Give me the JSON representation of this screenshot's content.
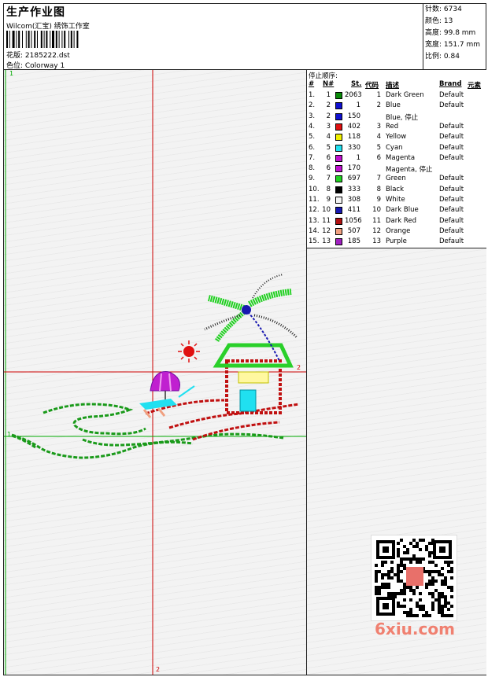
{
  "header": {
    "title": "生产作业图",
    "subtitle": "Wilcom(汇宝) 绣饰工作室",
    "design_file": "花版: 2185222.dst",
    "colorway": "色位: Colorway 1"
  },
  "stats": {
    "stitches": "针数: 6734",
    "colors": "颜色: 13",
    "height": "高度: 99.8 mm",
    "width": "宽度: 151.7 mm",
    "scale": "比例: 0.84"
  },
  "canvas": {
    "marker_top_left": "1",
    "marker_right": "2",
    "marker_bottom": "2",
    "marker_left": "1"
  },
  "stop_table": {
    "heading": "停止顺序:",
    "columns": [
      "#",
      "N#",
      "St.",
      "代码",
      "描述",
      "Brand",
      "元素"
    ],
    "rows": [
      {
        "idx": "1.",
        "n": "1",
        "color": "#0a8a0a",
        "st": "2063",
        "code": "1",
        "desc": "Dark Green",
        "brand": "Default"
      },
      {
        "idx": "2.",
        "n": "2",
        "color": "#1010d0",
        "st": "1",
        "code": "2",
        "desc": "Blue",
        "brand": "Default"
      },
      {
        "idx": "3.",
        "n": "2",
        "color": "#1010d0",
        "st": "150",
        "code": "",
        "desc": "Blue, 停止",
        "brand": ""
      },
      {
        "idx": "4.",
        "n": "3",
        "color": "#e01010",
        "st": "402",
        "code": "3",
        "desc": "Red",
        "brand": "Default"
      },
      {
        "idx": "5.",
        "n": "4",
        "color": "#f0f000",
        "st": "118",
        "code": "4",
        "desc": "Yellow",
        "brand": "Default"
      },
      {
        "idx": "6.",
        "n": "5",
        "color": "#20e0f0",
        "st": "330",
        "code": "5",
        "desc": "Cyan",
        "brand": "Default"
      },
      {
        "idx": "7.",
        "n": "6",
        "color": "#c010d0",
        "st": "1",
        "code": "6",
        "desc": "Magenta",
        "brand": "Default"
      },
      {
        "idx": "8.",
        "n": "6",
        "color": "#c010d0",
        "st": "170",
        "code": "",
        "desc": "Magenta, 停止",
        "brand": ""
      },
      {
        "idx": "9.",
        "n": "7",
        "color": "#20d020",
        "st": "697",
        "code": "7",
        "desc": "Green",
        "brand": "Default"
      },
      {
        "idx": "10.",
        "n": "8",
        "color": "#000000",
        "st": "333",
        "code": "8",
        "desc": "Black",
        "brand": "Default"
      },
      {
        "idx": "11.",
        "n": "9",
        "color": "#f4f4f4",
        "st": "308",
        "code": "9",
        "desc": "White",
        "brand": "Default"
      },
      {
        "idx": "12.",
        "n": "10",
        "color": "#1818b0",
        "st": "411",
        "code": "10",
        "desc": "Dark Blue",
        "brand": "Default"
      },
      {
        "idx": "13.",
        "n": "11",
        "color": "#b01010",
        "st": "1056",
        "code": "11",
        "desc": "Dark Red",
        "brand": "Default"
      },
      {
        "idx": "14.",
        "n": "12",
        "color": "#f0a080",
        "st": "507",
        "code": "12",
        "desc": "Orange",
        "brand": "Default"
      },
      {
        "idx": "15.",
        "n": "13",
        "color": "#a020c0",
        "st": "185",
        "code": "13",
        "desc": "Purple",
        "brand": "Default"
      }
    ]
  },
  "watermark": {
    "site": "6xiu.com"
  },
  "colors": {
    "guide_red": "#cc0000",
    "guide_green": "#00aa00"
  }
}
